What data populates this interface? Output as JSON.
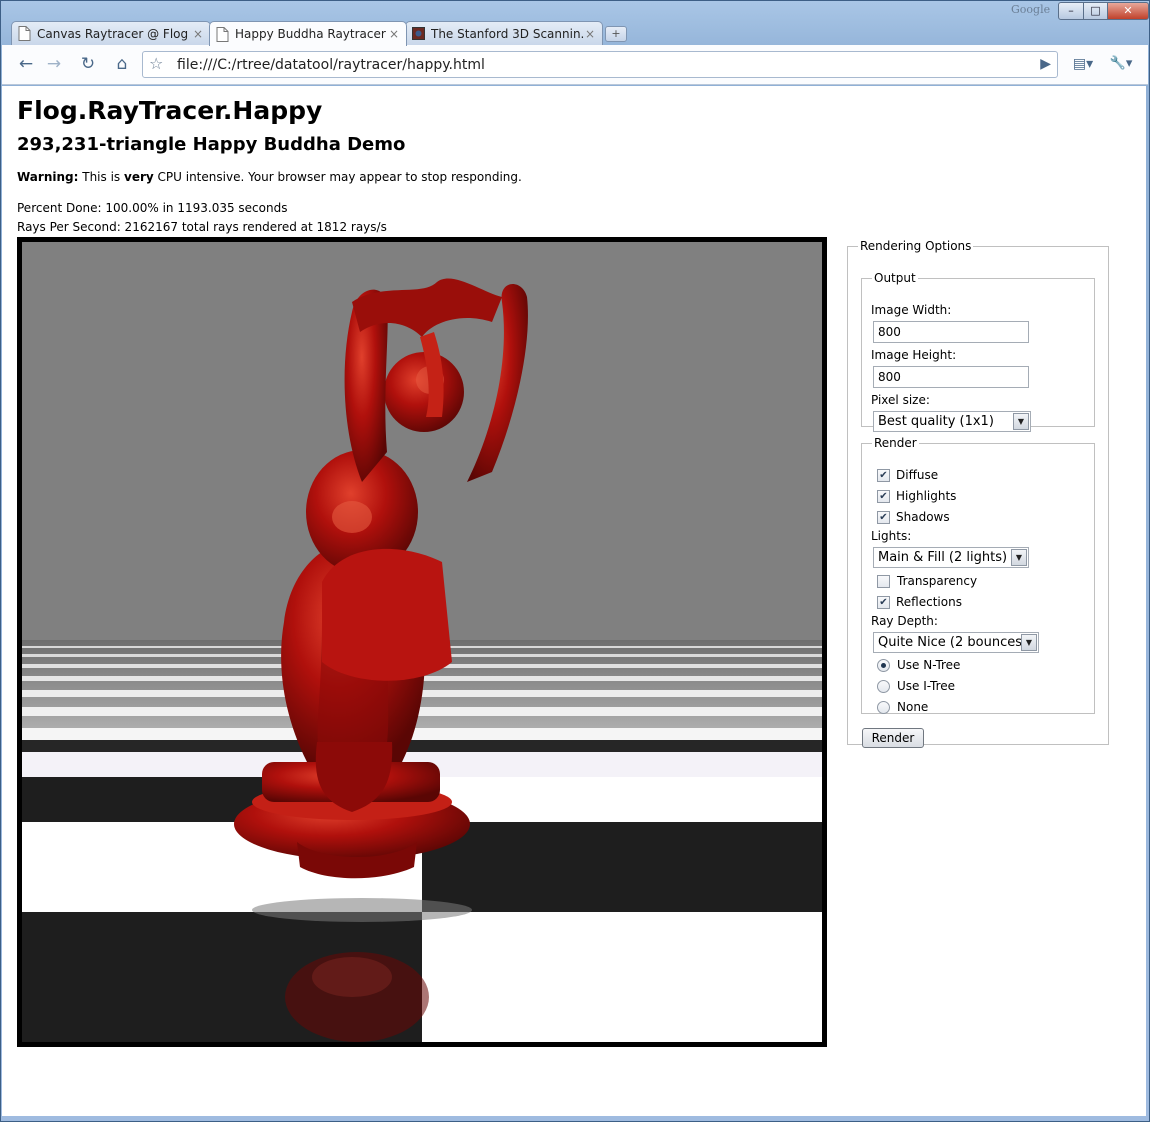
{
  "browser": {
    "brand": "Google",
    "tabs": [
      {
        "label": "Canvas Raytracer @ Flog",
        "close": "×"
      },
      {
        "label": "Happy Buddha Raytracer ...",
        "close": "×"
      },
      {
        "label": "The Stanford 3D Scannin...",
        "close": "×"
      }
    ],
    "new_tab": "+",
    "window_buttons": {
      "minimize": "–",
      "maximize": "□",
      "close": "✕"
    },
    "toolbar": {
      "back": "←",
      "forward": "→",
      "reload": "↻",
      "home": "⌂",
      "bookmark": "☆",
      "go": "▶",
      "page_menu": "▤▾",
      "tools_menu": "🔧▾"
    },
    "url": "file:///C:/rtree/datatool/raytracer/happy.html"
  },
  "page": {
    "title": "Flog.RayTracer.Happy",
    "subtitle": "293,231-triangle Happy Buddha Demo",
    "warning": {
      "label": "Warning:",
      "pre": "This is",
      "emph": "very",
      "post": "CPU intensive. Your browser may appear to stop responding."
    },
    "percent_done": "Percent Done: 100.00% in 1193.035 seconds",
    "rays_per_second": "Rays Per Second: 2162167 total rays rendered at 1812 rays/s"
  },
  "options": {
    "legend": "Rendering Options",
    "output": {
      "legend": "Output",
      "width_label": "Image Width:",
      "width_value": "800",
      "height_label": "Image Height:",
      "height_value": "800",
      "pixel_size_label": "Pixel size:",
      "pixel_size_value": "Best quality (1x1)"
    },
    "render": {
      "legend": "Render",
      "diffuse": {
        "label": "Diffuse",
        "checked": true
      },
      "highlights": {
        "label": "Highlights",
        "checked": true
      },
      "shadows": {
        "label": "Shadows",
        "checked": true
      },
      "lights_label": "Lights:",
      "lights_value": "Main & Fill (2 lights)",
      "transparency": {
        "label": "Transparency",
        "checked": false
      },
      "reflections": {
        "label": "Reflections",
        "checked": true
      },
      "ray_depth_label": "Ray Depth:",
      "ray_depth_value": "Quite Nice (2 bounces)",
      "tree_options": [
        {
          "label": "Use N-Tree",
          "selected": true
        },
        {
          "label": "Use I-Tree",
          "selected": false
        },
        {
          "label": "None",
          "selected": false
        }
      ]
    },
    "render_button": "Render"
  },
  "colors": {
    "buddha_red": "#b0100c",
    "sky_gray": "#808080",
    "floor_dark": "#1e1e1e",
    "floor_light": "#ffffff"
  }
}
